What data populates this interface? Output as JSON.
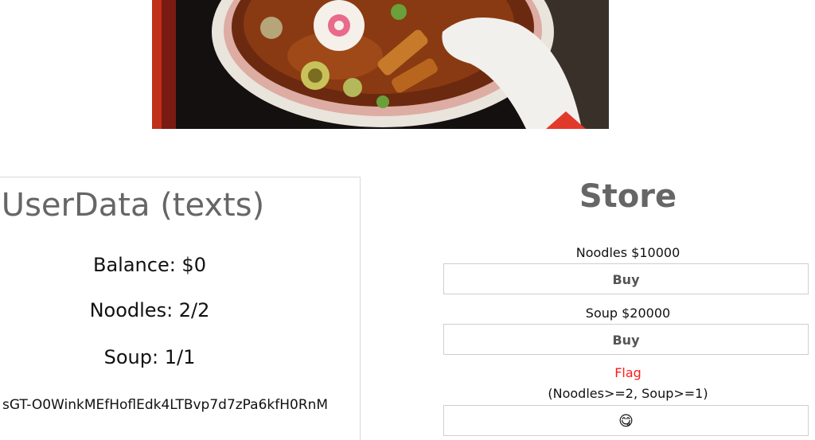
{
  "userdata": {
    "title": "UserData (texts)",
    "balance": "Balance: $0",
    "noodles": "Noodles: 2/2",
    "soup": "Soup: 1/1",
    "token": "sGT-O0WinkMEfHoflEdk4LTBvp7d7zPa6kfH0RnM"
  },
  "store": {
    "title": "Store",
    "items": [
      {
        "label": "Noodles $10000",
        "button": "Buy"
      },
      {
        "label": "Soup $20000",
        "button": "Buy"
      }
    ],
    "flag": {
      "label": "Flag",
      "requirement": "(Noodles>=2, Soup>=1)",
      "button": "😋"
    }
  }
}
